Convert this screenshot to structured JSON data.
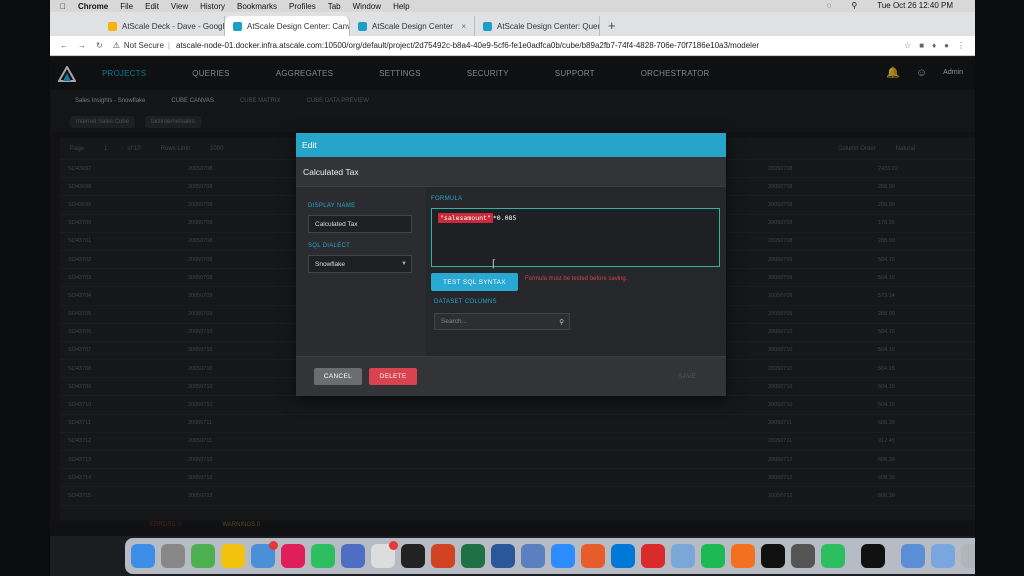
{
  "menubar": {
    "app": "Chrome",
    "items": [
      "File",
      "Edit",
      "View",
      "History",
      "Bookmarks",
      "Profiles",
      "Tab",
      "Window",
      "Help"
    ],
    "clock": "Tue Oct 26  12:40 PM"
  },
  "browser": {
    "tabs": [
      {
        "label": "AtScale Deck - Dave - Google"
      },
      {
        "label": "AtScale Design Center: Canvas"
      },
      {
        "label": "AtScale Design Center"
      },
      {
        "label": "AtScale Design Center: Queries"
      }
    ],
    "not_secure": "Not Secure",
    "url": "atscale-node-01.docker.infra.atscale.com:10500/org/default/project/2d75492c-b8a4-40e9-5cf6-fe1e0adfca0b/cube/b89a2fb7-74f4-4828-706e-70f7186e10a3/modeler"
  },
  "appnav": {
    "items": [
      "PROJECTS",
      "QUERIES",
      "AGGREGATES",
      "SETTINGS",
      "SECURITY",
      "SUPPORT",
      "ORCHESTRATOR"
    ],
    "user": "Admin"
  },
  "subnav": {
    "breadcrumb": "Sales Insights - Snowflake",
    "tabs": [
      "CUBE CANVAS",
      "CUBE MATRIX",
      "CUBE DATA PREVIEW"
    ],
    "cube": "Internet Sales Cube",
    "table": "factinternetsales"
  },
  "grid": {
    "page_label": "Page",
    "page_value": "1",
    "page_of": "of 10",
    "row_limit_label": "Rows Limit",
    "row_limit_value": "1000",
    "column_order_label": "Column Order",
    "column_order_value": "Natural",
    "orders": [
      "SO43697",
      "SO43698",
      "SO43699",
      "SO43700",
      "SO43701",
      "SO43702",
      "SO43703",
      "SO43704",
      "SO43705",
      "SO43706",
      "SO43707",
      "SO43708",
      "SO43709",
      "SO43710",
      "SO43711",
      "SO43712",
      "SO43713",
      "SO43714",
      "SO43715"
    ],
    "dates": [
      "20050708",
      "20050708",
      "20050708",
      "20050708",
      "20050708",
      "20050709",
      "20050709",
      "20050709",
      "20050709",
      "20050710",
      "20050710",
      "20050710",
      "20050710",
      "20050710",
      "20050711",
      "20050711",
      "20050712",
      "20050712",
      "20050712"
    ],
    "calc": [
      "2433.22",
      "288.99",
      "288.99",
      "178.26",
      "288.99",
      "504.15",
      "504.15",
      "573.14",
      "288.99",
      "504.15",
      "504.15",
      "504.15",
      "504.15",
      "504.15",
      "608.30",
      "912.45",
      "608.30",
      "608.30",
      "608.30"
    ]
  },
  "footer": {
    "errors": "ERRORS 0",
    "warnings": "WARNINGS 0"
  },
  "modal": {
    "header": "Edit",
    "title": "Calculated Tax",
    "display_name_label": "DISPLAY NAME",
    "display_name_value": "Calculated Tax",
    "sql_dialect_label": "SQL DIALECT",
    "sql_dialect_value": "Snowflake",
    "formula_label": "FORMULA",
    "formula_field": "\"salesamount\"",
    "formula_rest": "*0.085",
    "test_button": "TEST SQL SYNTAX",
    "error_message": "Formula must be tested before saving.",
    "dataset_columns_label": "DATASET COLUMNS",
    "search_placeholder": "Search...",
    "cancel": "CANCEL",
    "delete": "DELETE",
    "save": "SAVE"
  }
}
